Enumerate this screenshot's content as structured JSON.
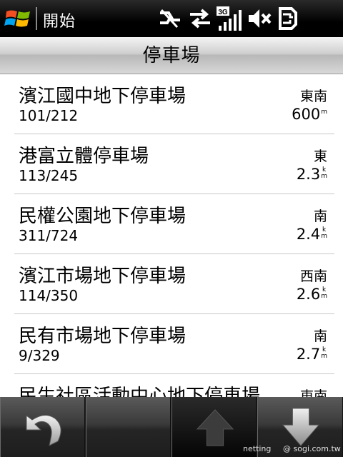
{
  "statusbar": {
    "start_label": "開始",
    "icons": [
      "windows-flag-icon",
      "sync-off-icon",
      "data-arrows-icon",
      "3g-signal-icon",
      "volume-mute-icon",
      "battery-charging-icon"
    ],
    "network_label": "3G"
  },
  "header": {
    "title": "停車場"
  },
  "list": {
    "items": [
      {
        "name": "濱江國中地下停車場",
        "count": "101/212",
        "direction": "東南",
        "distance": "600",
        "unit": "m"
      },
      {
        "name": "港富立體停車場",
        "count": "113/245",
        "direction": "東",
        "distance": "2.3",
        "unit": "km"
      },
      {
        "name": "民權公園地下停車場",
        "count": "311/724",
        "direction": "南",
        "distance": "2.4",
        "unit": "km"
      },
      {
        "name": "濱江市場地下停車場",
        "count": "114/350",
        "direction": "西南",
        "distance": "2.6",
        "unit": "km"
      },
      {
        "name": "民有市場地下停車場",
        "count": "9/329",
        "direction": "南",
        "distance": "2.7",
        "unit": "km"
      },
      {
        "name": "民生社區活動中心地下停車場",
        "count": "",
        "direction": "東南",
        "distance": "",
        "unit": ""
      }
    ]
  },
  "toolbar": {
    "buttons": [
      "back-icon",
      "",
      "arrow-up-icon",
      "arrow-down-icon"
    ]
  },
  "watermark": {
    "left": "netting",
    "right": "@ sogi.com.tw"
  },
  "colors": {
    "statusbar_bg": "#000000",
    "title_bg": "#cfcfcf",
    "divider": "#c8c8c8",
    "toolbar_bg": "#1a1a1a"
  }
}
